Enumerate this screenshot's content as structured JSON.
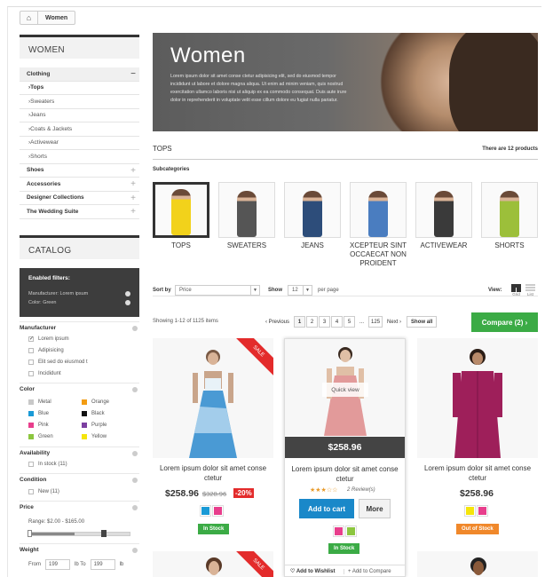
{
  "breadcrumb": {
    "home_icon": "home-icon",
    "current": "Women"
  },
  "categories": {
    "title": "WOMEN",
    "items": [
      {
        "label": "Clothing",
        "top": true,
        "sign": "−"
      },
      {
        "label": "Tops",
        "top": false,
        "bold": true
      },
      {
        "label": "Sweaters"
      },
      {
        "label": "Jeans"
      },
      {
        "label": "Coats & Jackets"
      },
      {
        "label": "Activewear"
      },
      {
        "label": "Shorts"
      },
      {
        "label": "Shoes",
        "top": true,
        "sign": "+"
      },
      {
        "label": "Accessories",
        "top": true,
        "sign": "+"
      },
      {
        "label": "Designer Collections",
        "top": true,
        "sign": "+"
      },
      {
        "label": "The Wedding Suite",
        "top": true,
        "sign": "+"
      }
    ]
  },
  "catalog": {
    "title": "CATALOG",
    "enabled_title": "Enabled filters:",
    "enabled": [
      "Manufacturer: Lorem ipsum",
      "Color: Green"
    ],
    "manufacturer": {
      "label": "Manufacturer",
      "options": [
        {
          "label": "Lorem ipsum",
          "checked": true
        },
        {
          "label": "Adipisicing",
          "checked": false
        },
        {
          "label": "Elit sed do eiusmod t",
          "checked": false
        },
        {
          "label": "Incididunt",
          "checked": false
        }
      ]
    },
    "color": {
      "label": "Color",
      "options": [
        {
          "label": "Metal",
          "color": "#c8c8c8"
        },
        {
          "label": "Orange",
          "color": "#f39c12"
        },
        {
          "label": "Blue",
          "color": "#1a9ad6"
        },
        {
          "label": "Black",
          "color": "#111111"
        },
        {
          "label": "Pink",
          "color": "#e83e8c"
        },
        {
          "label": "Purple",
          "color": "#7b3fa0"
        },
        {
          "label": "Green",
          "color": "#8cc63f"
        },
        {
          "label": "Yellow",
          "color": "#f5e50b"
        }
      ]
    },
    "availability": {
      "label": "Availability",
      "option": "In stock (11)"
    },
    "condition": {
      "label": "Condition",
      "option": "New (11)"
    },
    "price": {
      "label": "Price",
      "range": "Range: $2.00 - $165.00",
      "slider_fraction": 0.45
    },
    "weight": {
      "label": "Weight",
      "from_label": "From",
      "from": "199",
      "unit1": "lb To",
      "to": "199",
      "unit2": "lb"
    }
  },
  "banner": {
    "title": "Women",
    "text": "Lorem ipsum dolor sit amet conse ctetur adipisicing elit, sed do eiusmod tempor incididunt ut labore et dolore magna aliqua. Ut enim ad minim veniam, quis nostrud exercitation ullamco laboris nisi ut aliquip ex ea commodo consequat. Duis aute irure dolor in reprehenderit in voluptate velit esse cillum dolore eu fugiat nulla pariatur."
  },
  "section": {
    "title": "TOPS",
    "count": "There are 12 products"
  },
  "subcategories": {
    "title": "Subcategories",
    "items": [
      {
        "label": "TOPS",
        "color": "#f2d21b"
      },
      {
        "label": "SWEATERS",
        "color": "#555555"
      },
      {
        "label": "JEANS",
        "color": "#2d4d7a"
      },
      {
        "label": "XCEPTEUR SINT OCCAECAT NON PROIDENT",
        "color": "#4a7dc0"
      },
      {
        "label": "ACTIVEWEAR",
        "color": "#3a3a3a"
      },
      {
        "label": "SHORTS",
        "color": "#9cbf3a"
      }
    ]
  },
  "toolbar": {
    "sort_label": "Sort by",
    "sort_value": "Price",
    "show_label": "Show",
    "show_value": "12",
    "per_page": "per page",
    "view_label": "View:",
    "grid": "Grid",
    "list": "List",
    "showing": "Showing 1-12 of 1125 items",
    "prev": "‹ Previous",
    "pages": [
      "1",
      "2",
      "3",
      "4",
      "5",
      "...",
      "125"
    ],
    "next": "Next ›",
    "show_all": "Show all",
    "compare": "Compare (2) ›"
  },
  "products": [
    {
      "name": "Lorem ipsum dolor sit amet conse ctetur",
      "price": "$258.96",
      "old_price": "$328.96",
      "discount": "-20%",
      "ribbon": "SALE",
      "colors": [
        "#1a9ad6",
        "#e83e8c"
      ],
      "stock": "In Stock",
      "stock_color": "#3bab45"
    },
    {
      "name": "Lorem ipsum dolor sit amet conse ctetur",
      "price": "$258.96",
      "quick_view": "Quick view",
      "rating": "★★★☆☆",
      "reviews": "2 Review(s)",
      "add_to_cart": "Add to cart",
      "more": "More",
      "colors": [
        "#e83e8c",
        "#8cc63f"
      ],
      "stock": "In Stock",
      "stock_color": "#3bab45",
      "wishlist": "Add to Wishlist",
      "add_compare": "Add to Compare"
    },
    {
      "name": "Lorem ipsum dolor sit amet conse ctetur",
      "price": "$258.96",
      "colors": [
        "#f5e50b",
        "#e83e8c"
      ],
      "stock": "Out of Stock",
      "stock_color": "#f0882b"
    }
  ],
  "second_row_ribbon": "SALE"
}
